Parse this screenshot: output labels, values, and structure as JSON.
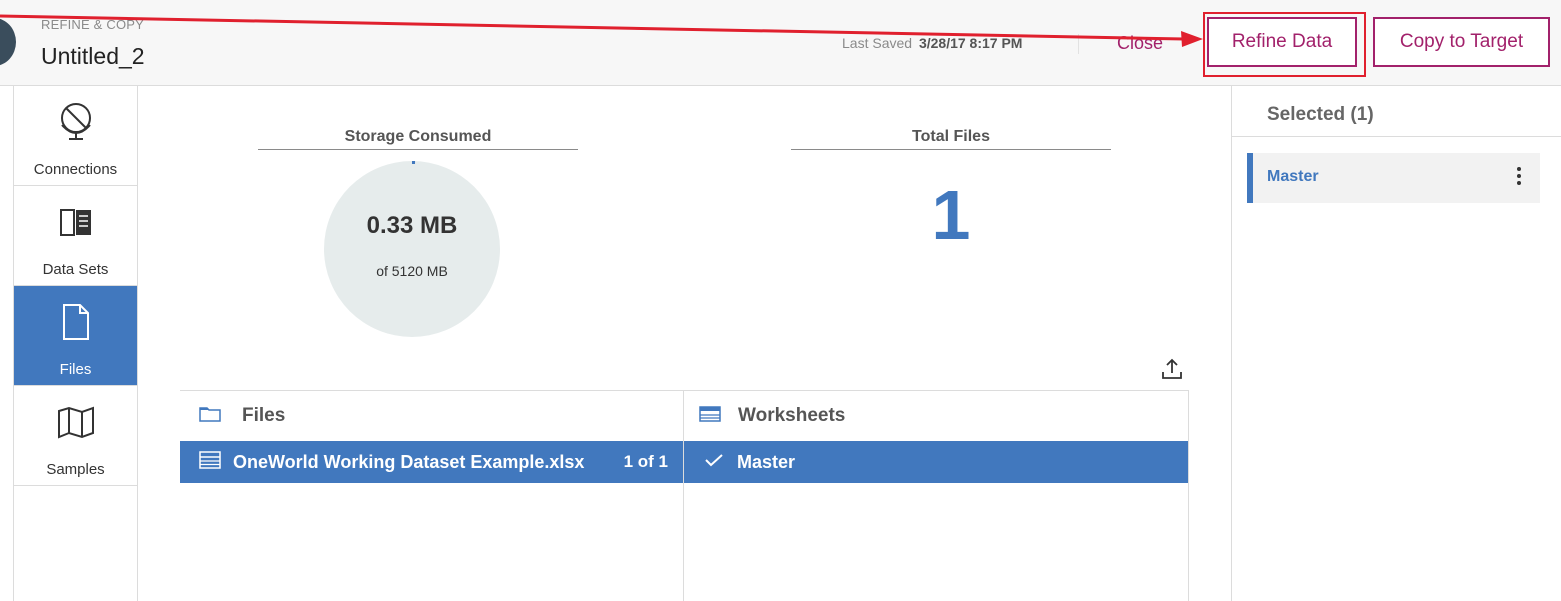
{
  "header": {
    "eyebrow": "REFINE & COPY",
    "title": "Untitled_2",
    "last_saved_label": "Last Saved",
    "last_saved_value": "3/28/17 8:17 PM",
    "close_label": "Close",
    "refine_label": "Refine Data",
    "copy_label": "Copy to Target"
  },
  "sidebar": {
    "items": [
      {
        "label": "Connections",
        "icon": "globe-icon",
        "active": false
      },
      {
        "label": "Data Sets",
        "icon": "book-icon",
        "active": false
      },
      {
        "label": "Files",
        "icon": "file-icon",
        "active": true
      },
      {
        "label": "Samples",
        "icon": "map-icon",
        "active": false
      }
    ]
  },
  "stats": {
    "storage_title": "Storage Consumed",
    "storage_value": "0.33 MB",
    "storage_sub": "of 5120 MB",
    "storage_used_mb": 0.33,
    "storage_total_mb": 5120,
    "files_title": "Total Files",
    "files_value": "1"
  },
  "files_panel": {
    "title": "Files",
    "row_label": "OneWorld Working Dataset Example.xlsx",
    "row_count": "1 of 1"
  },
  "worksheets_panel": {
    "title": "Worksheets",
    "row_label": "Master"
  },
  "selected_panel": {
    "title": "Selected (1)",
    "item_label": "Master"
  },
  "colors": {
    "accent": "#a2216b",
    "primary_blue": "#4178be",
    "annotation_red": "#e0202e",
    "donut_bg": "#e6ecec"
  }
}
